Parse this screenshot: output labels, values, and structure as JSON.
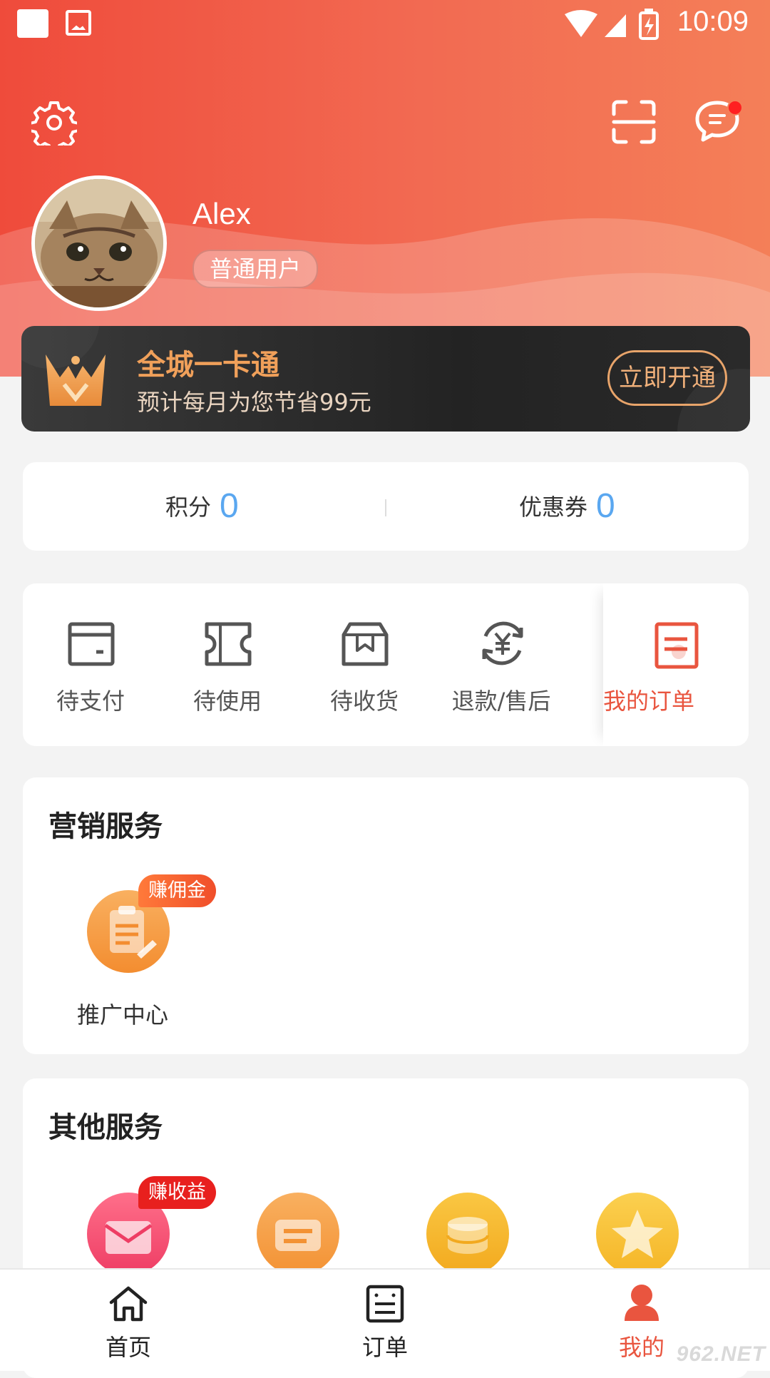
{
  "status_bar": {
    "time": "10:09"
  },
  "colors": {
    "accent": "#e9553f",
    "header_start": "#ef4b3b",
    "header_end": "#f47f58",
    "number_blue": "#5aa7f0",
    "gold": "#f0a05a"
  },
  "profile": {
    "username": "Alex",
    "badge": "普通用户"
  },
  "vip_card": {
    "title": "全城一卡通",
    "subtitle": "预计每月为您节省99元",
    "button": "立即开通"
  },
  "stats": {
    "points_label": "积分",
    "points_value": "0",
    "coupons_label": "优惠券",
    "coupons_value": "0"
  },
  "orders": {
    "items": [
      {
        "label": "待支付",
        "icon": "wallet-icon"
      },
      {
        "label": "待使用",
        "icon": "ticket-icon"
      },
      {
        "label": "待收货",
        "icon": "box-icon"
      },
      {
        "label": "退款/售后",
        "icon": "refund-icon"
      }
    ],
    "my_orders": {
      "label": "我的订单",
      "icon": "order-list-icon"
    }
  },
  "marketing": {
    "title": "营销服务",
    "items": [
      {
        "label": "推广中心",
        "tag": "赚佣金",
        "icon": "clipboard-icon"
      }
    ]
  },
  "other": {
    "title": "其他服务",
    "items": [
      {
        "tag": "赚收益",
        "icon": "mail-icon",
        "color": "#f0567a"
      },
      {
        "icon": "card-icon",
        "color": "#f5a040"
      },
      {
        "icon": "coins-icon",
        "color": "#f5b830"
      },
      {
        "icon": "star-icon",
        "color": "#f8c23a"
      }
    ]
  },
  "bottom_nav": {
    "items": [
      {
        "label": "首页",
        "icon": "home-icon"
      },
      {
        "label": "订单",
        "icon": "order-icon"
      },
      {
        "label": "我的",
        "icon": "user-icon",
        "active": true
      }
    ]
  },
  "watermark": "962.NET"
}
